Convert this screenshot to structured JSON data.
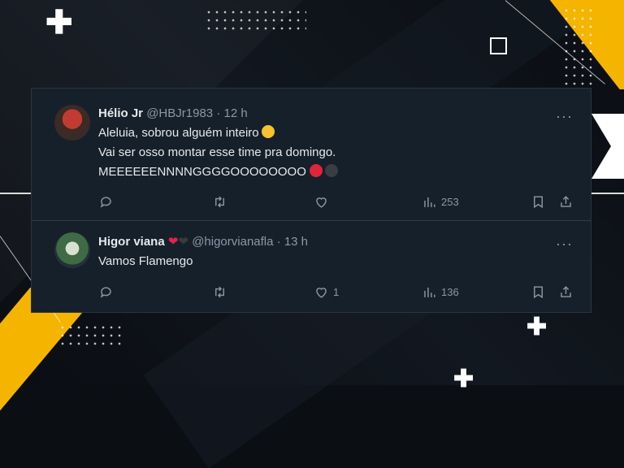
{
  "tweets": [
    {
      "name": "Hélio Jr",
      "handle": "@HBJr1983",
      "separator": "·",
      "time": "12 h",
      "lines": [
        "Aleluia, sobrou alguém inteiro",
        "Vai ser osso montar esse time pra domingo.",
        "MEEEEEENNNNGGGGOOOOOOOO"
      ],
      "stats": {
        "replies": "",
        "retweets": "",
        "likes": "",
        "views": "253"
      }
    },
    {
      "name": "Higor viana",
      "name_emojis": [
        "❤",
        "❤"
      ],
      "handle": "@higorvianafla",
      "separator": "·",
      "time": "13 h",
      "lines": [
        "Vamos Flamengo"
      ],
      "stats": {
        "replies": "",
        "retweets": "",
        "likes": "1",
        "views": "136"
      }
    }
  ],
  "more_glyph": "···",
  "icons": [
    "reply-icon",
    "retweet-icon",
    "like-icon",
    "views-icon",
    "bookmark-icon",
    "share-icon"
  ],
  "colors": {
    "card_bg": "#15202b",
    "text": "#e7e9ea",
    "muted": "#8b98a5",
    "accent_yellow": "#f5b400",
    "heart_red": "#e0244a"
  }
}
